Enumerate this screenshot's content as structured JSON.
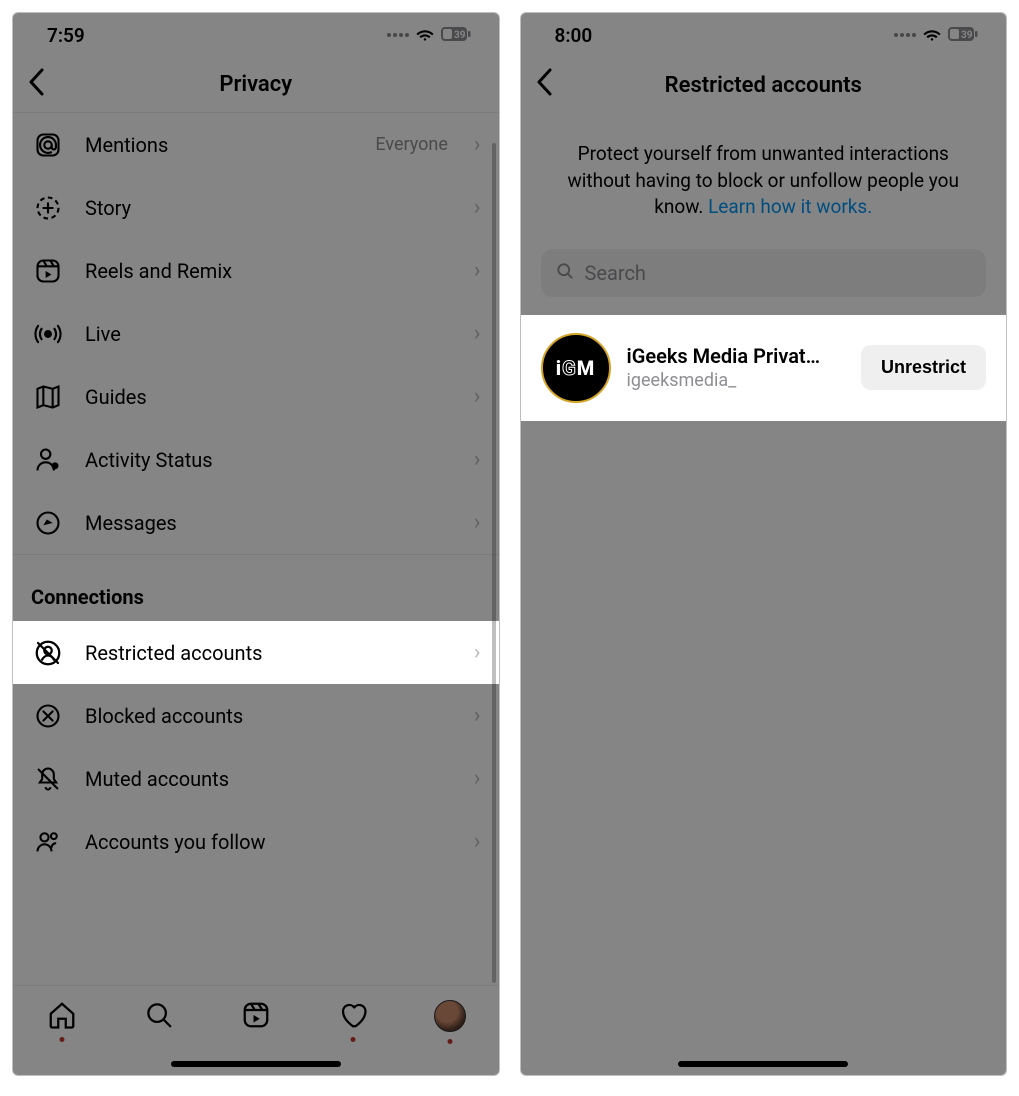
{
  "left": {
    "status_time": "7:59",
    "battery": "39",
    "header_title": "Privacy",
    "rows": [
      {
        "label": "Mentions",
        "value": "Everyone"
      },
      {
        "label": "Story"
      },
      {
        "label": "Reels and Remix"
      },
      {
        "label": "Live"
      },
      {
        "label": "Guides"
      },
      {
        "label": "Activity Status"
      },
      {
        "label": "Messages"
      }
    ],
    "section_title": "Connections",
    "conn_rows": [
      {
        "label": "Restricted accounts",
        "hl": true
      },
      {
        "label": "Blocked accounts"
      },
      {
        "label": "Muted accounts"
      },
      {
        "label": "Accounts you follow"
      }
    ]
  },
  "right": {
    "status_time": "8:00",
    "battery": "39",
    "header_title": "Restricted accounts",
    "intro_text": "Protect yourself from unwanted interactions without having to block or unfollow people you know. ",
    "intro_link": "Learn how it works.",
    "search_placeholder": "Search",
    "account": {
      "display_name": "iGeeks Media Privat…",
      "handle": "igeeksmedia_",
      "avatar_text": "iGM",
      "button": "Unrestrict"
    }
  }
}
